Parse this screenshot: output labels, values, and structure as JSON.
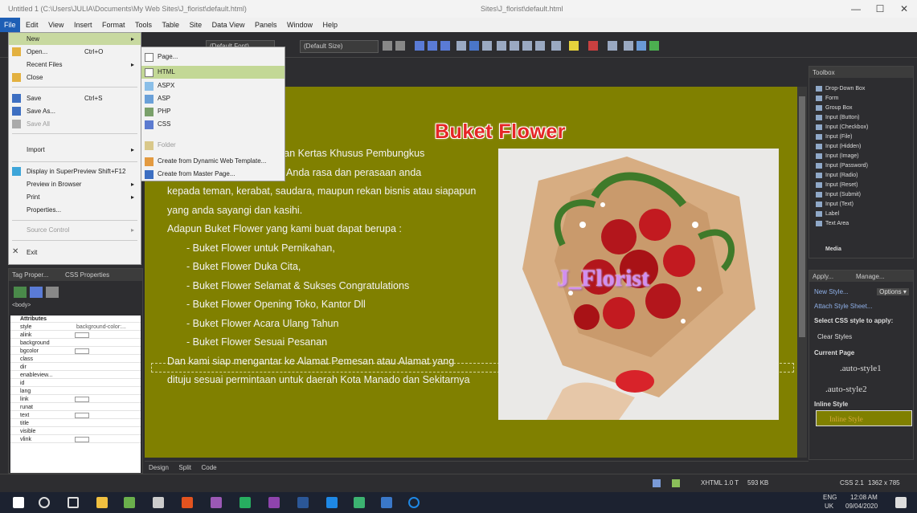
{
  "window": {
    "title": "Untitled 1 (C:\\Users\\JULIA\\Documents\\My Web Sites\\J_florist\\default.html)",
    "center_title": "Sites\\J_florist\\default.html",
    "min": "—",
    "max": "☐",
    "close": "✕"
  },
  "menubar": [
    "File",
    "Edit",
    "View",
    "Insert",
    "Format",
    "Tools",
    "Table",
    "Site",
    "Data View",
    "Panels",
    "Window",
    "Help"
  ],
  "file_menu": {
    "items": [
      {
        "label": "New",
        "shortcut": "",
        "arrow": "▸",
        "highlight": true
      },
      {
        "label": "Open...",
        "shortcut": "Ctrl+O",
        "arrow": ""
      },
      {
        "label": "Recent Files",
        "shortcut": "",
        "arrow": "▸"
      },
      {
        "label": "Close",
        "shortcut": "",
        "arrow": ""
      },
      {
        "label": "Save",
        "shortcut": "Ctrl+S",
        "arrow": ""
      },
      {
        "label": "Save As...",
        "shortcut": "",
        "arrow": ""
      },
      {
        "label": "Save All",
        "shortcut": "",
        "arrow": "",
        "disabled": true
      },
      {
        "label": "Import",
        "shortcut": "",
        "arrow": "▸"
      },
      {
        "label": "Display in SuperPreview",
        "shortcut": "Shift+F12",
        "arrow": ""
      },
      {
        "label": "Preview in Browser",
        "shortcut": "",
        "arrow": "▸"
      },
      {
        "label": "Print",
        "shortcut": "",
        "arrow": "▸"
      },
      {
        "label": "Properties...",
        "shortcut": "",
        "arrow": ""
      },
      {
        "label": "Source Control",
        "shortcut": "",
        "arrow": "▸",
        "disabled": true
      },
      {
        "label": "Exit",
        "shortcut": "",
        "arrow": ""
      }
    ]
  },
  "new_submenu": {
    "items": [
      {
        "label": "Page...",
        "highlight": false
      },
      {
        "label": "HTML",
        "highlight": true
      },
      {
        "label": "ASPX",
        "highlight": false
      },
      {
        "label": "ASP",
        "highlight": false
      },
      {
        "label": "PHP",
        "highlight": false
      },
      {
        "label": "CSS",
        "highlight": false
      },
      {
        "label": "Folder",
        "disabled": true
      },
      {
        "label": "Create from Dynamic Web Template..."
      },
      {
        "label": "Create from Master Page..."
      }
    ]
  },
  "toolbar": {
    "font_select": "(Default Font)",
    "size_select": "(Default Size)"
  },
  "page": {
    "heading": "Buket Flower",
    "watermark": "J_Florist",
    "lines": [
      "Buket Bunga dengan Hiasan Kertas Khusus Pembungkus",
      "Bunga, sebagai ungkapan Anda rasa dan perasaan anda",
      "kepada teman, kerabat, saudara, maupun rekan bisnis atau siapapun",
      "yang anda sayangi dan kasihi.",
      "Adapun Buket Flower yang kami buat dapat berupa :"
    ],
    "list": [
      "- Buket Flower untuk Pernikahan,",
      "- Buket Flower Duka Cita,",
      "- Buket Flower Selamat & Sukses Congratulations",
      "- Buket Flower Opening Toko, Kantor Dll",
      "- Buket Flower Acara Ulang Tahun",
      "- Buket Flower Sesuai Pesanan"
    ],
    "closing": [
      "Dan kami siap mengantar ke Alamat Pemesan atau Alamat yang",
      "dituju sesuai permintaan untuk daerah Kota Manado dan Sekitarnya"
    ]
  },
  "view_tabs": [
    "Design",
    "Split",
    "Code"
  ],
  "left_panel": {
    "tab1": "Tag Proper...",
    "tab2": "CSS Properties",
    "tag": "<body>",
    "section": "Attributes",
    "rows": [
      {
        "k": "style",
        "v": "background-color:..."
      },
      {
        "k": "alink",
        "v": ""
      },
      {
        "k": "background",
        "v": ""
      },
      {
        "k": "bgcolor",
        "v": ""
      },
      {
        "k": "class",
        "v": ""
      },
      {
        "k": "dir",
        "v": ""
      },
      {
        "k": "enableview...",
        "v": ""
      },
      {
        "k": "id",
        "v": ""
      },
      {
        "k": "lang",
        "v": ""
      },
      {
        "k": "link",
        "v": ""
      },
      {
        "k": "runat",
        "v": ""
      },
      {
        "k": "text",
        "v": ""
      },
      {
        "k": "title",
        "v": ""
      },
      {
        "k": "visible",
        "v": ""
      },
      {
        "k": "vlink",
        "v": ""
      }
    ]
  },
  "toolbox": {
    "title": "Toolbox",
    "items": [
      "Drop-Down Box",
      "Form",
      "Group Box",
      "Input (Button)",
      "Input (Checkbox)",
      "Input (File)",
      "Input (Hidden)",
      "Input (Image)",
      "Input (Password)",
      "Input (Radio)",
      "Input (Reset)",
      "Input (Submit)",
      "Input (Text)",
      "Label",
      "Text Area"
    ],
    "media": "Media"
  },
  "apply_panel": {
    "tab1": "Apply...",
    "tab2": "Manage...",
    "new_style": "New Style...",
    "options": "Options ▾",
    "attach": "Attach Style Sheet...",
    "select_label": "Select CSS style to apply:",
    "clear": "Clear Styles",
    "current_page": "Current Page",
    "style1": ".auto-style1",
    "style2": ".auto-style2",
    "inline_label": "Inline Style",
    "inline_style": "Inline Style"
  },
  "statusbar": {
    "doctype": "XHTML 1.0 T",
    "size": "593 KB",
    "css": "CSS 2.1",
    "dims": "1362 x 785"
  },
  "taskbar": {
    "lang": "ENG",
    "region": "UK",
    "time": "12:08 AM",
    "date": "09/04/2020"
  },
  "colors": {
    "page_bg": "#808000",
    "heading": "#e52626",
    "menu_highlight": "#c8d9a0"
  }
}
